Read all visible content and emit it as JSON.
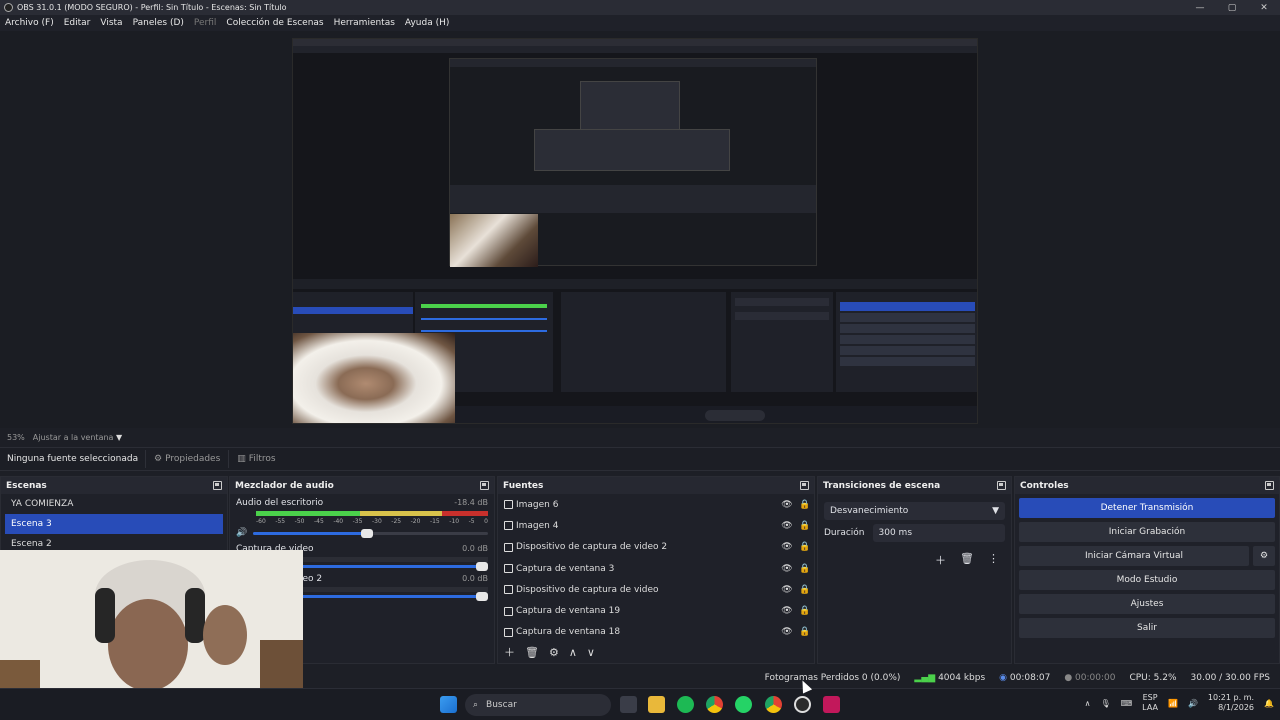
{
  "window": {
    "title": "OBS 31.0.1 (MODO SEGURO) - Perfil: Sin Título - Escenas: Sin Título",
    "min": "—",
    "max": "▢",
    "close": "✕"
  },
  "menu": {
    "items": [
      "Archivo (F)",
      "Editar",
      "Vista",
      "Paneles (D)",
      "Perfil",
      "Colección de Escenas",
      "Herramientas",
      "Ayuda (H)"
    ]
  },
  "preview": {
    "zoom": "53%",
    "fit_label": "Ajustar a la ventana"
  },
  "source_toolbar": {
    "no_source": "Ninguna fuente seleccionada",
    "properties": "Propiedades",
    "filters": "Filtros"
  },
  "scenes": {
    "title": "Escenas",
    "items": [
      "YA COMIENZA",
      "Escena 3",
      "Escena 2"
    ],
    "selected": "Escena 3"
  },
  "mixer": {
    "title": "Mezclador de audio",
    "scale": [
      "-60",
      "-55",
      "-50",
      "-45",
      "-40",
      "-35",
      "-30",
      "-25",
      "-20",
      "-15",
      "-10",
      "-5",
      "0"
    ],
    "channels": [
      {
        "name": "Audio del escritorio",
        "db": "-18.4 dB"
      },
      {
        "name": "Captura de video",
        "db": "0.0 dB"
      },
      {
        "name": "Captura de video 2",
        "db": "0.0 dB"
      }
    ]
  },
  "sources": {
    "title": "Fuentes",
    "items": [
      "Imagen 6",
      "Imagen 4",
      "Dispositivo de captura de video 2",
      "Captura de ventana 3",
      "Dispositivo de captura de video",
      "Captura de ventana 19",
      "Captura de ventana 18"
    ]
  },
  "transitions": {
    "title": "Transiciones de escena",
    "selected": "Desvanecimiento",
    "duration_label": "Duración",
    "duration_value": "300 ms"
  },
  "controls": {
    "title": "Controles",
    "buttons": [
      "Detener Transmisión",
      "Iniciar Grabación",
      "Iniciar Cámara Virtual",
      "Modo Estudio",
      "Ajustes",
      "Salir"
    ]
  },
  "status": {
    "dropped": "Fotogramas Perdidos 0 (0.0%)",
    "bitrate": "4004 kbps",
    "stream_time": "00:08:07",
    "rec_time": "00:00:00",
    "cpu": "CPU: 5.2%",
    "fps": "30.00 / 30.00 FPS"
  },
  "taskbar": {
    "search": "Buscar",
    "lang": "ESP",
    "lang2": "LAA",
    "time": "10:21 p. m.",
    "date": "8/1/2026"
  },
  "colors": {
    "accent": "#284cb8",
    "bg": "#1f2129"
  }
}
